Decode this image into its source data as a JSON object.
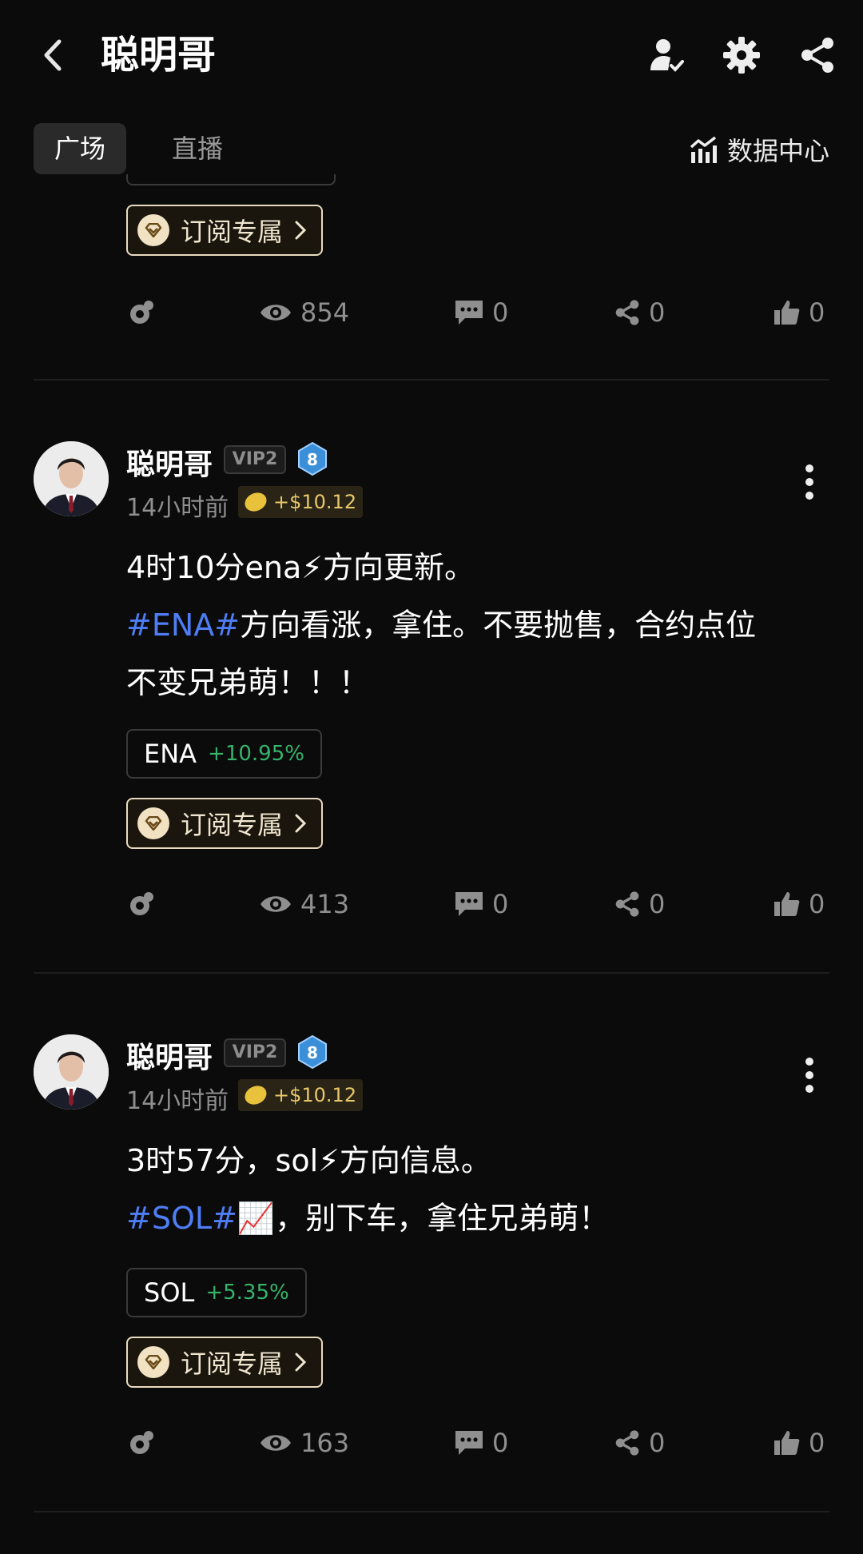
{
  "header": {
    "title": "聪明哥",
    "icons": [
      "back-icon",
      "profile-icon",
      "gear-icon",
      "share-icon"
    ]
  },
  "tabs": [
    {
      "label": "广场",
      "active": true
    },
    {
      "label": "直播",
      "active": false
    }
  ],
  "data_center_label": "数据中心",
  "subscribe_label": "订阅专属",
  "posts": [
    {
      "stats": {
        "views": "854",
        "comments": "0",
        "shares": "0",
        "likes": "0"
      }
    },
    {
      "author": "聪明哥",
      "vip": "VIP2",
      "level": "8",
      "time": "14小时前",
      "reward": "+$10.12",
      "line1": "4时10分ena⚡方向更新。",
      "tag": "#ENA#",
      "line2_rest": "方向看涨，拿住。不要抛售，合约点位",
      "line3": "不变兄弟萌！！！",
      "ticker": {
        "symbol": "ENA",
        "change": "+10.95%"
      },
      "stats": {
        "views": "413",
        "comments": "0",
        "shares": "0",
        "likes": "0"
      }
    },
    {
      "author": "聪明哥",
      "vip": "VIP2",
      "level": "8",
      "time": "14小时前",
      "reward": "+$10.12",
      "line1": "3时57分，sol⚡方向信息。",
      "tag": "#SOL#",
      "line2_rest": "📈，别下车，拿住兄弟萌！",
      "ticker": {
        "symbol": "SOL",
        "change": "+5.35%"
      },
      "stats": {
        "views": "163",
        "comments": "0",
        "shares": "0",
        "likes": "0"
      }
    }
  ],
  "colors": {
    "background": "#0b0b0b",
    "hashtag": "#4f7df5",
    "positive": "#35b46a",
    "reward": "#e8c86a"
  }
}
